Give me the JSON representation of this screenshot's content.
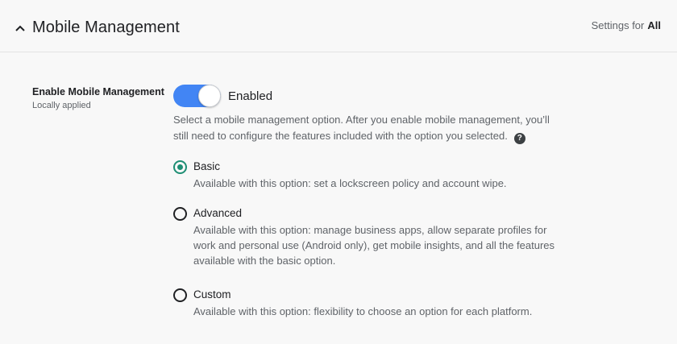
{
  "header": {
    "title": "Mobile Management",
    "settings_for_label": "Settings for",
    "settings_for_scope": "All",
    "collapse_icon": "chevron-up-icon"
  },
  "setting": {
    "label": "Enable Mobile Management",
    "sublabel": "Locally applied",
    "toggle_state": "Enabled",
    "toggle_on": true,
    "description": "Select a mobile management option. After you enable mobile management, you’ll still need to configure the features included with the option you selected.",
    "help_icon": "help-icon"
  },
  "options": [
    {
      "title": "Basic",
      "description": "Available with this option: set a lockscreen policy and account wipe.",
      "selected": true
    },
    {
      "title": "Advanced",
      "description": "Available with this option: manage business apps, allow separate profiles for work and personal use (Android only), get mobile insights, and all the features available with the basic option.",
      "selected": false
    },
    {
      "title": "Custom",
      "description": "Available with this option: flexibility to choose an option for each platform.",
      "selected": false
    }
  ],
  "colors": {
    "toggle_accent": "#4285f4",
    "radio_accent": "#1e8e74"
  }
}
